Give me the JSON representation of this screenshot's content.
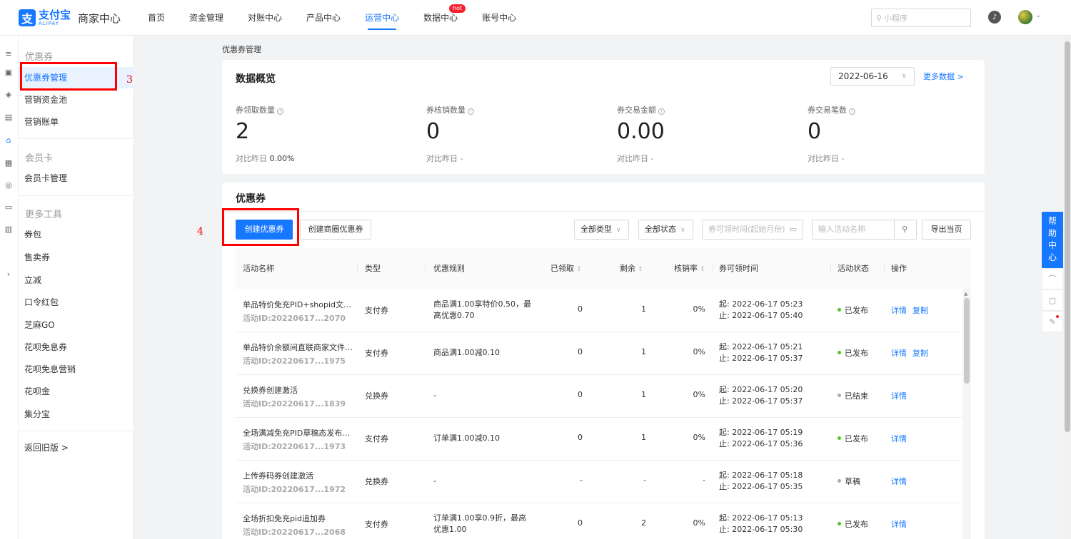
{
  "header": {
    "logo_cn": "支付宝",
    "logo_en": "ALIPAY",
    "app_title": "商家中心",
    "nav": [
      {
        "label": "首页"
      },
      {
        "label": "资金管理"
      },
      {
        "label": "对账中心"
      },
      {
        "label": "产品中心"
      },
      {
        "label": "运营中心",
        "active": true
      },
      {
        "label": "数据中心",
        "badge": "hot"
      },
      {
        "label": "账号中心"
      }
    ],
    "search_placeholder": "小程序"
  },
  "sidebar": {
    "groups": [
      {
        "title": "优惠券",
        "items": [
          "优惠券管理",
          "营销资金池",
          "营销账单"
        ]
      },
      {
        "title": "会员卡",
        "items": [
          "会员卡管理"
        ]
      },
      {
        "title": "更多工具",
        "items": [
          "券包",
          "售卖券",
          "立减",
          "口令红包",
          "芝麻GO",
          "花呗免息券",
          "花呗免息营销",
          "花呗金",
          "集分宝"
        ]
      }
    ],
    "active_item": "优惠券管理",
    "back_old": "返回旧版 >"
  },
  "annotations": [
    "3",
    "4"
  ],
  "breadcrumb": "优惠券管理",
  "overview": {
    "title": "数据概览",
    "date": "2022-06-16",
    "more_link": "更多数据 >",
    "stats": [
      {
        "label": "券领取数量",
        "value": "2",
        "compare_label": "对比昨日",
        "compare_value": "0.00%"
      },
      {
        "label": "券核销数量",
        "value": "0",
        "compare_label": "对比昨日",
        "compare_value": "-"
      },
      {
        "label": "券交易金额",
        "value": "0.00",
        "compare_label": "对比昨日",
        "compare_value": "-"
      },
      {
        "label": "券交易笔数",
        "value": "0",
        "compare_label": "对比昨日",
        "compare_value": "-"
      }
    ]
  },
  "coupons": {
    "title": "优惠券",
    "create_button": "创建优惠券",
    "create_district_button": "创建商圈优惠券",
    "filter_type": "全部类型",
    "filter_status": "全部状态",
    "time_placeholder": "券可领时间(起始月份)",
    "name_placeholder": "输入活动名称",
    "export_button": "导出当页",
    "columns": [
      "活动名称",
      "类型",
      "优惠规则",
      "已领取",
      "剩余",
      "核销率",
      "券可领时间",
      "活动状态",
      "操作"
    ],
    "rows": [
      {
        "name": "单品特价免充PID+shopid文件上传",
        "id": "活动ID:20220617...2070",
        "type": "支付券",
        "rule": "商品满1.00享特价0.50，最高优惠0.70",
        "claimed": "0",
        "remaining": "1",
        "rate": "0%",
        "start": "起: 2022-06-17 05:23",
        "end": "止: 2022-06-17 05:40",
        "status": "已发布",
        "status_color": "#52c41a",
        "actions": [
          "详情",
          "复制"
        ]
      },
      {
        "name": "单品特价余额间直联商家文件上传",
        "id": "活动ID:20220617...1975",
        "type": "支付券",
        "rule": "商品满1.00减0.10",
        "claimed": "0",
        "remaining": "1",
        "rate": "0%",
        "start": "起: 2022-06-17 05:21",
        "end": "止: 2022-06-17 05:37",
        "status": "已发布",
        "status_color": "#52c41a",
        "actions": [
          "详情",
          "复制"
        ]
      },
      {
        "name": "兑换券创建激活",
        "id": "活动ID:20220617...1839",
        "type": "兑换券",
        "rule": "-",
        "claimed": "0",
        "remaining": "1",
        "rate": "0%",
        "start": "起: 2022-06-17 05:20",
        "end": "止: 2022-06-17 05:37",
        "status": "已结束",
        "status_color": "#aaaaaa",
        "actions": [
          "详情"
        ]
      },
      {
        "name": "全场满减免充PID草稿态发布激活",
        "id": "活动ID:20220617...1973",
        "type": "支付券",
        "rule": "订单满1.00减0.10",
        "claimed": "0",
        "remaining": "1",
        "rate": "0%",
        "start": "起: 2022-06-17 05:19",
        "end": "止: 2022-06-17 05:36",
        "status": "已发布",
        "status_color": "#52c41a",
        "actions": [
          "详情"
        ]
      },
      {
        "name": "上传券码券创建激活",
        "id": "活动ID:20220617...1972",
        "type": "兑换券",
        "rule": "-",
        "claimed": "-",
        "remaining": "-",
        "rate": "-",
        "start": "起: 2022-06-17 05:18",
        "end": "止: 2022-06-17 05:35",
        "status": "草稿",
        "status_color": "#aaaaaa",
        "actions": [
          "详情"
        ]
      },
      {
        "name": "全场折扣免充pid追加券",
        "id": "活动ID:20220617...2068",
        "type": "支付券",
        "rule": "订单满1.00享0.9折，最高优惠1.00",
        "claimed": "0",
        "remaining": "2",
        "rate": "0%",
        "start": "起: 2022-06-17 05:13",
        "end": "止: 2022-06-17 05:30",
        "status": "已发布",
        "status_color": "#52c41a",
        "actions": [
          "详情"
        ]
      }
    ]
  },
  "help_center": "帮助中心",
  "colors": {
    "accent": "#1677ff",
    "highlight": "#ff0000"
  }
}
